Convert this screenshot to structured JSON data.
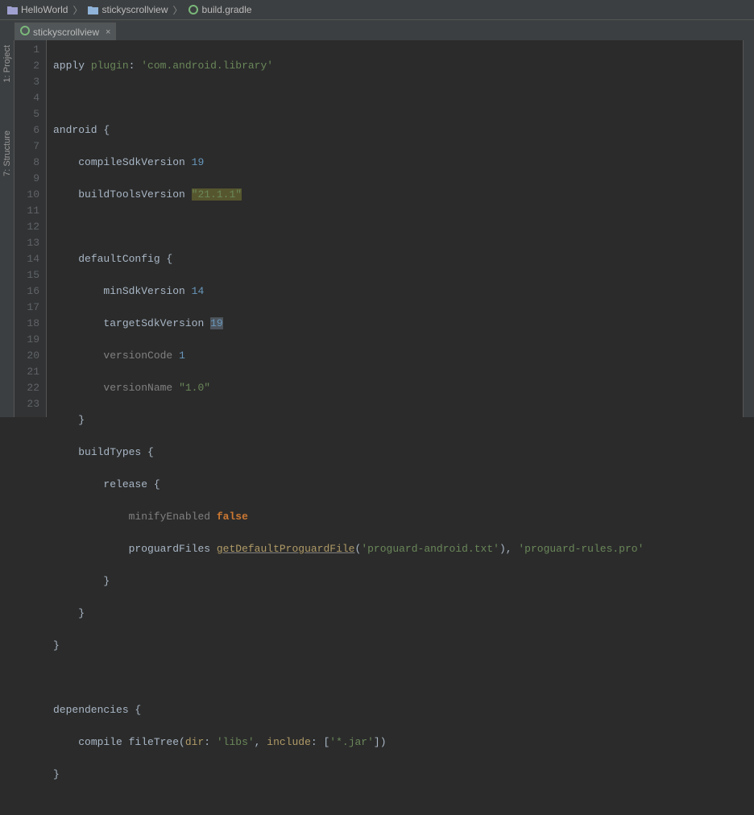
{
  "breadcrumb": {
    "root": "HelloWorld",
    "module": "stickyscrollview",
    "file": "build.gradle"
  },
  "tab": {
    "label": "stickyscrollview",
    "close": "×"
  },
  "rail": {
    "project": "1: Project",
    "structure": "7: Structure"
  },
  "code": {
    "l1_apply": "apply",
    "l1_plugin": "plugin",
    "l1_colon": ": ",
    "l1_val": "'com.android.library'",
    "l3_android": "android {",
    "l4_key": "compileSdkVersion",
    "l4_val": "19",
    "l5_key": "buildToolsVersion",
    "l5_val": "\"21.1.1\"",
    "l7_key": "defaultConfig {",
    "l8_key": "minSdkVersion",
    "l8_val": "14",
    "l9_key": "targetSdkVersion",
    "l9_val": "19",
    "l10_key": "versionCode",
    "l10_val": "1",
    "l11_key": "versionName",
    "l11_val": "\"1.0\"",
    "l12": "}",
    "l13": "buildTypes {",
    "l14": "release {",
    "l15_key": "minifyEnabled",
    "l15_val": "false",
    "l16_key": "proguardFiles",
    "l16_method": "getDefaultProguardFile",
    "l16_arg1": "'proguard-android.txt'",
    "l16_paren": "), ",
    "l16_arg2": "'proguard-rules.pro'",
    "l17": "}",
    "l18": "}",
    "l19": "}",
    "l21": "dependencies {",
    "l22_compile": "compile fileTree(",
    "l22_dir": "dir",
    "l22_dirval": "'libs'",
    "l22_comma": ", ",
    "l22_inc": "include",
    "l22_incval": "'*.jar'",
    "l22_close": "])",
    "l23": "}"
  }
}
